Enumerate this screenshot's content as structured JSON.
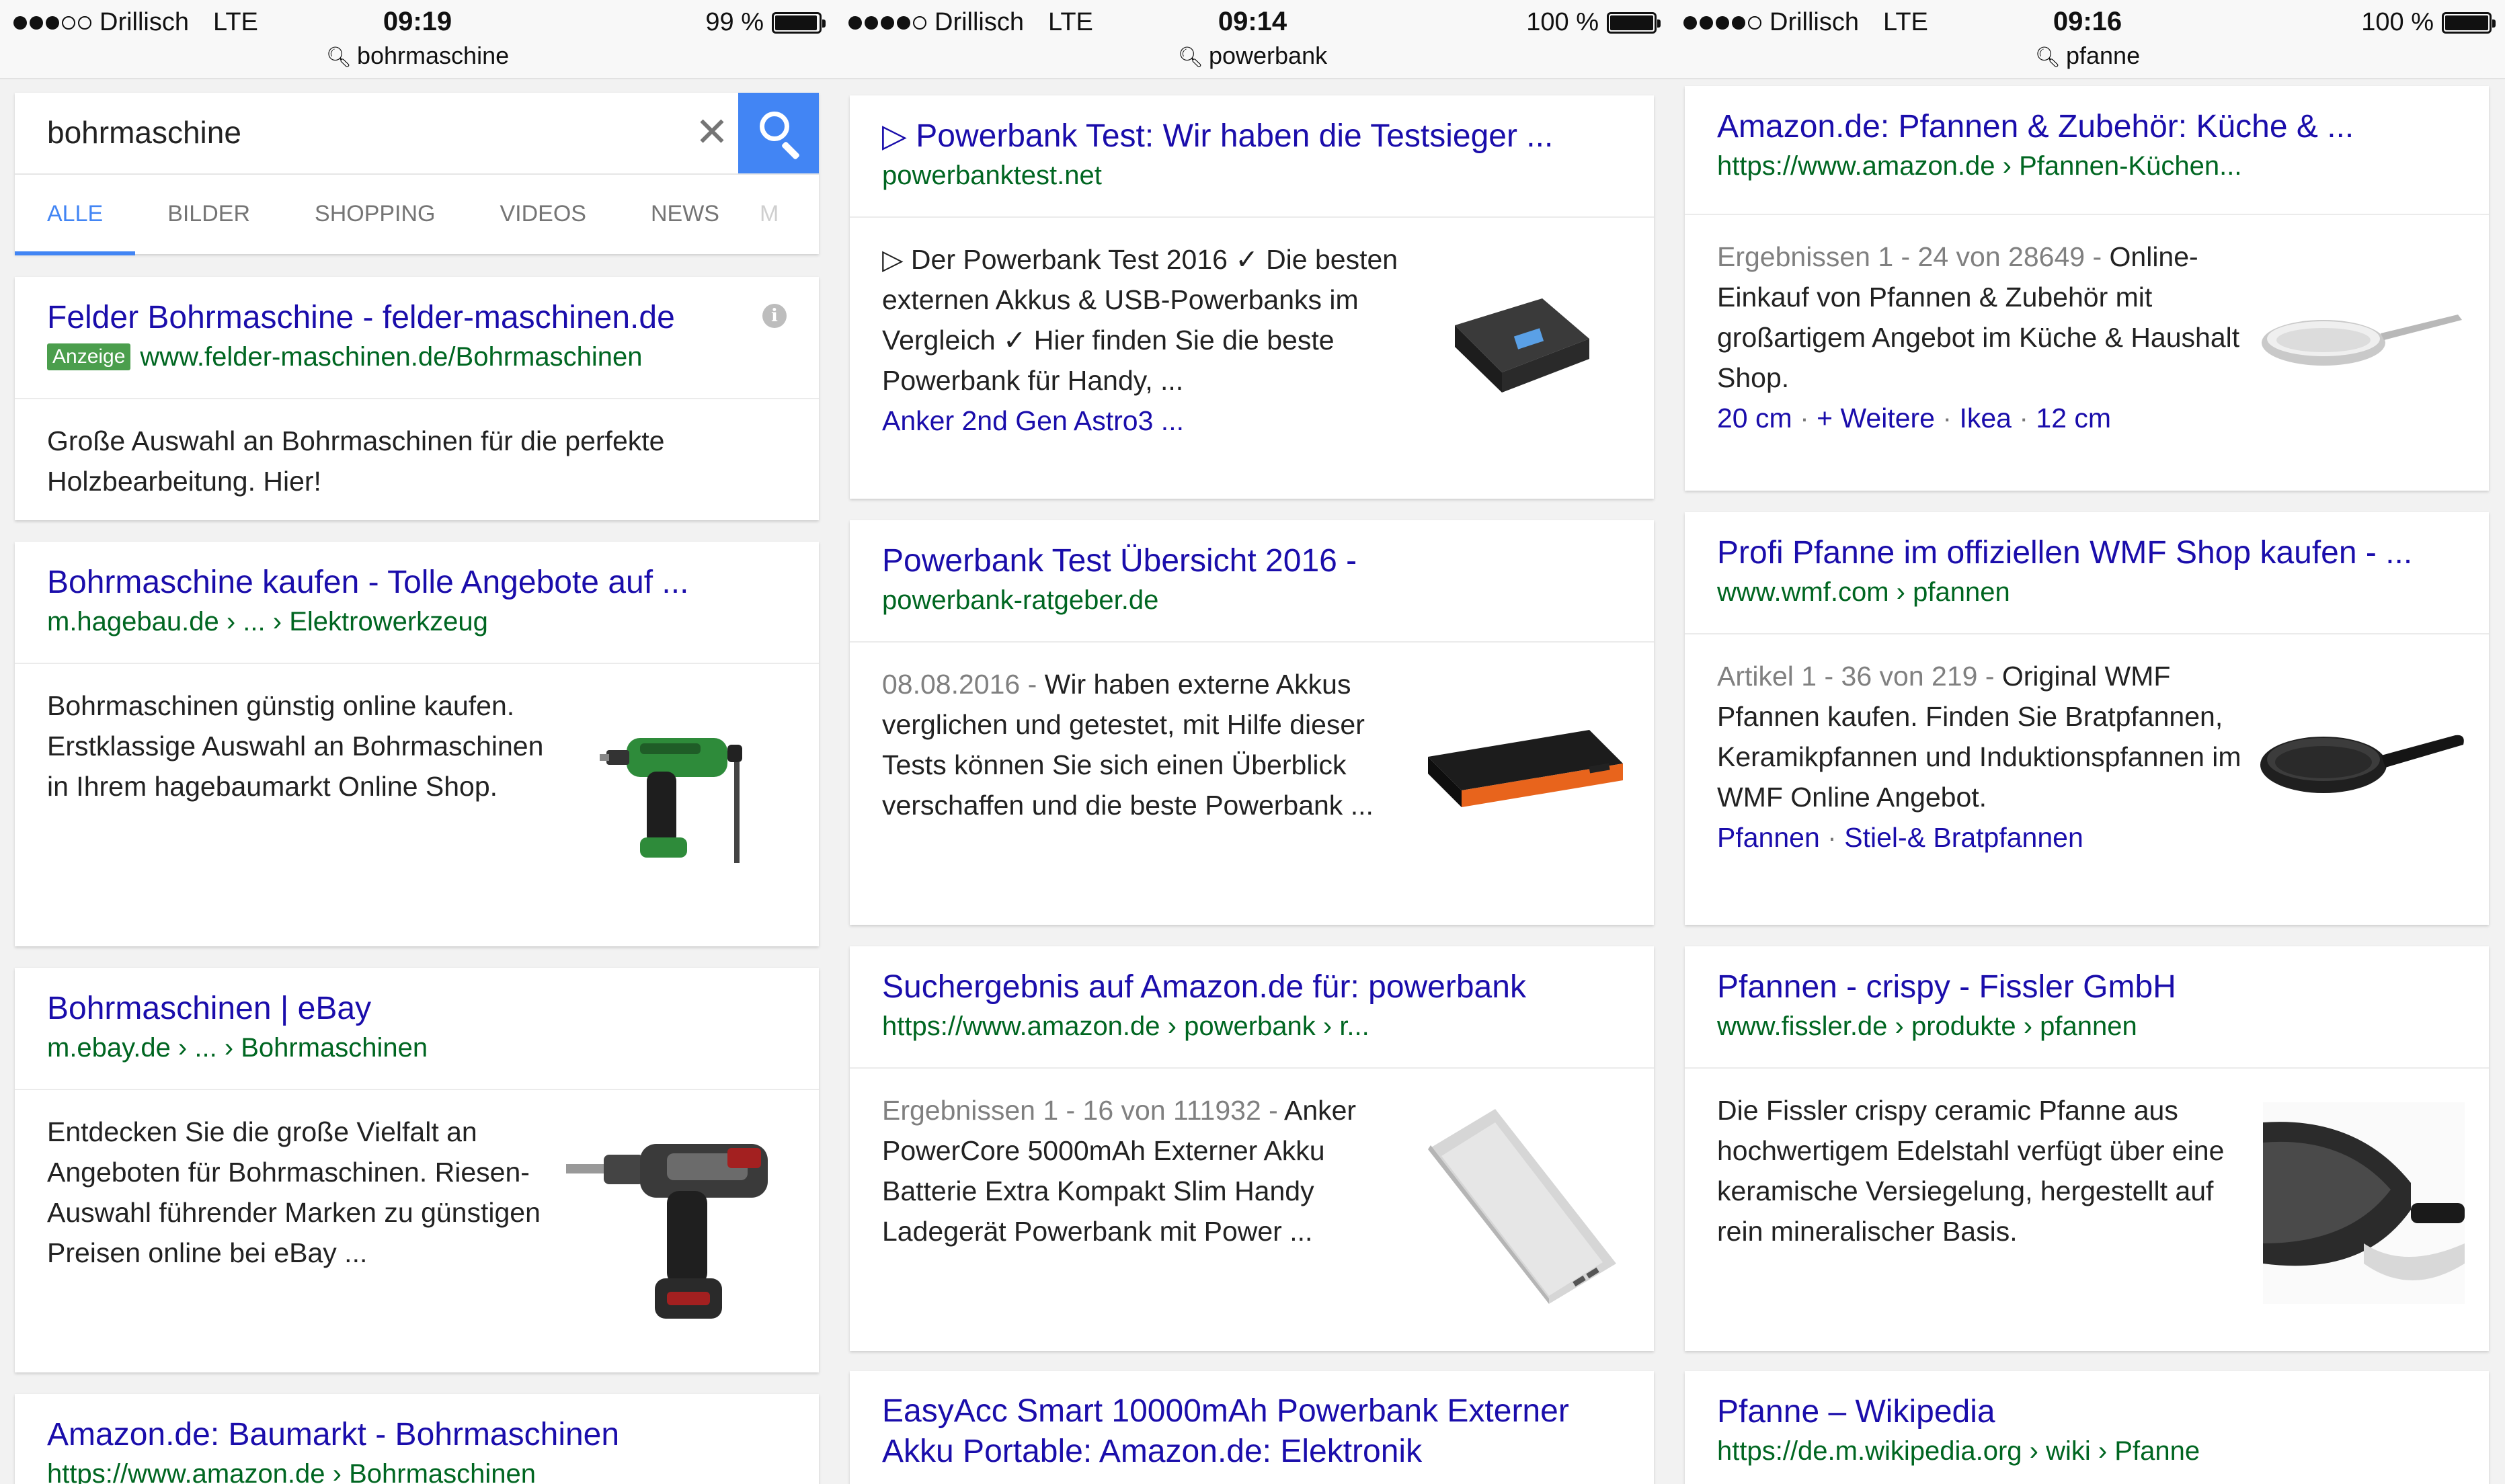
{
  "screens": [
    {
      "status": {
        "carrier": "Drillisch",
        "network": "LTE",
        "time": "09:19",
        "battery": "99 %",
        "battery_level": 0.99,
        "signal_bars": 3,
        "url": "bohrmaschine"
      },
      "search": {
        "query": "bohrmaschine",
        "tabs": [
          "ALLE",
          "BILDER",
          "SHOPPING",
          "VIDEOS",
          "NEWS",
          "M"
        ],
        "active_tab": "ALLE"
      },
      "results": [
        {
          "title": "Felder Bohrmaschine - felder-maschinen.de",
          "ad_label": "Anzeige",
          "url": "www.felder-maschinen.de/Bohrmaschinen",
          "snippet": "Große Auswahl an Bohrmaschinen für die perfekte Holzbearbeitung. Hier!"
        },
        {
          "title": "Bohrmaschine kaufen - Tolle Angebote auf ...",
          "url": "m.hagebau.de › ... › Elektrowerkzeug",
          "snippet": "Bohrmaschinen günstig online kaufen. Erstklassige Auswahl an Bohrmaschinen in Ihrem hagebaumarkt Online Shop."
        },
        {
          "title": "Bohrmaschinen | eBay",
          "url": "m.ebay.de › ... › Bohrmaschinen",
          "snippet": "Entdecken Sie die große Vielfalt an Angeboten für Bohrmaschinen. Riesen-Auswahl führender Marken zu günstigen Preisen online bei eBay ..."
        },
        {
          "title": "Amazon.de: Baumarkt - Bohrmaschinen",
          "url": "https://www.amazon.de › Bohrmaschinen"
        }
      ]
    },
    {
      "status": {
        "carrier": "Drillisch",
        "network": "LTE",
        "time": "09:14",
        "battery": "100 %",
        "battery_level": 1.0,
        "signal_bars": 4,
        "url": "powerbank"
      },
      "results": [
        {
          "title": "▷ Powerbank Test: Wir haben die Testsieger ...",
          "url": "powerbanktest.net",
          "snippet": "▷ Der Powerbank Test 2016 ✓ Die besten externen Akkus & USB-Powerbanks im Vergleich ✓ Hier finden Sie die beste Powerbank für Handy, ...",
          "link": "Anker 2nd Gen Astro3 ..."
        },
        {
          "title": "Powerbank Test Übersicht 2016 -",
          "url": "powerbank-ratgeber.de",
          "date": "08.08.2016 -",
          "snippet": "Wir haben externe Akkus verglichen und getestet, mit Hilfe dieser Tests können Sie sich einen Überblick verschaffen und die beste Powerbank ..."
        },
        {
          "title": "Suchergebnis auf Amazon.de für: powerbank",
          "url": "https://www.amazon.de › powerbank › r...",
          "date": "Ergebnissen 1 - 16 von 111932 -",
          "snippet": "Anker PowerCore 5000mAh Externer Akku Batterie Extra Kompakt Slim Handy Ladegerät Powerbank mit Power ..."
        },
        {
          "title": "EasyAcc Smart 10000mAh Powerbank Externer Akku Portable: Amazon.de: Elektronik"
        }
      ]
    },
    {
      "status": {
        "carrier": "Drillisch",
        "network": "LTE",
        "time": "09:16",
        "battery": "100 %",
        "battery_level": 1.0,
        "signal_bars": 4,
        "url": "pfanne"
      },
      "results": [
        {
          "title": "Amazon.de: Pfannen & Zubehör: Küche & ...",
          "url": "https://www.amazon.de › Pfannen-Küchen...",
          "date": "Ergebnissen 1 - 24 von 28649 -",
          "snippet": "Online-Einkauf von Pfannen & Zubehör mit großartigem Angebot im Küche & Haushalt Shop.",
          "links": [
            "20 cm",
            "+ Weitere",
            "Ikea",
            "12 cm"
          ]
        },
        {
          "title": "Profi Pfanne im offiziellen WMF Shop kaufen - ...",
          "url": "www.wmf.com › pfannen",
          "date": "Artikel 1 - 36 von 219 -",
          "snippet": "Original WMF Pfannen kaufen. Finden Sie Bratpfannen, Keramikpfannen und Induktionspfannen im WMF Online Angebot.",
          "links": [
            "Pfannen",
            "Stiel-& Bratpfannen"
          ]
        },
        {
          "title": "Pfannen - crispy - Fissler GmbH",
          "url": "www.fissler.de › produkte › pfannen",
          "snippet": "Die Fissler crispy ceramic Pfanne aus hochwertigem Edelstahl verfügt über eine keramische Versiegelung, hergestellt auf rein mineralischer Basis."
        },
        {
          "title": "Pfanne – Wikipedia",
          "url": "https://de.m.wikipedia.org › wiki › Pfanne"
        }
      ]
    }
  ],
  "colors": {
    "link": "#1a0dab",
    "url": "#006621",
    "accent": "#4285f4",
    "ad_badge": "#4b9e4d"
  }
}
